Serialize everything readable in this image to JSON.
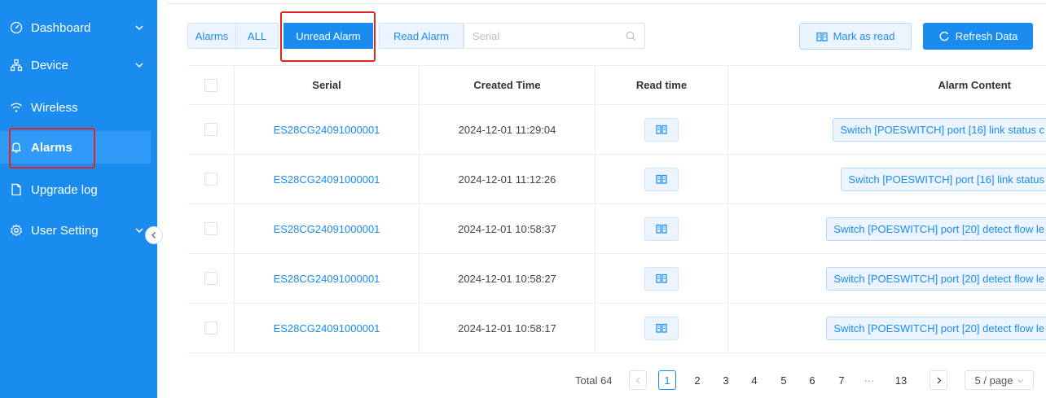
{
  "sidebar": {
    "items": [
      {
        "label": "Dashboard",
        "icon": "gauge-icon",
        "has_chevron": true
      },
      {
        "label": "Device",
        "icon": "network-icon",
        "has_chevron": true
      },
      {
        "label": "Wireless",
        "icon": "wifi-icon",
        "has_chevron": false
      },
      {
        "label": "Alarms",
        "icon": "bell-icon",
        "has_chevron": false,
        "active": true
      },
      {
        "label": "Upgrade log",
        "icon": "document-icon",
        "has_chevron": false
      },
      {
        "label": "User Setting",
        "icon": "gear-icon",
        "has_chevron": true
      }
    ]
  },
  "toolbar": {
    "tabs": [
      {
        "label": "Alarms"
      },
      {
        "label": "ALL"
      },
      {
        "label": "Unread Alarm",
        "active": true
      },
      {
        "label": "Read Alarm"
      }
    ],
    "search_placeholder": "Serial",
    "search_value": "",
    "mark_read_label": "Mark as read",
    "refresh_label": "Refresh Data"
  },
  "table": {
    "headers": [
      "",
      "Serial",
      "Created Time",
      "Read time",
      "Alarm Content"
    ],
    "rows": [
      {
        "serial": "ES28CG24091000001",
        "created": "2024-12-01 11:29:04",
        "content": "Switch [POESWITCH] port [16] link status c"
      },
      {
        "serial": "ES28CG24091000001",
        "created": "2024-12-01 11:12:26",
        "content": "Switch [POESWITCH] port [16] link status"
      },
      {
        "serial": "ES28CG24091000001",
        "created": "2024-12-01 10:58:37",
        "content": "Switch [POESWITCH] port [20] detect flow le"
      },
      {
        "serial": "ES28CG24091000001",
        "created": "2024-12-01 10:58:27",
        "content": "Switch [POESWITCH] port [20] detect flow le"
      },
      {
        "serial": "ES28CG24091000001",
        "created": "2024-12-01 10:58:17",
        "content": "Switch [POESWITCH] port [20] detect flow le"
      }
    ]
  },
  "pagination": {
    "total_label": "Total 64",
    "pages": [
      "1",
      "2",
      "3",
      "4",
      "5",
      "6",
      "7",
      "···",
      "13"
    ],
    "current": "1",
    "page_size_label": "5 / page"
  },
  "colors": {
    "sidebar_bg": "#1a8cf0",
    "accent": "#1a8cf0",
    "highlight_box": "#e0241f"
  }
}
